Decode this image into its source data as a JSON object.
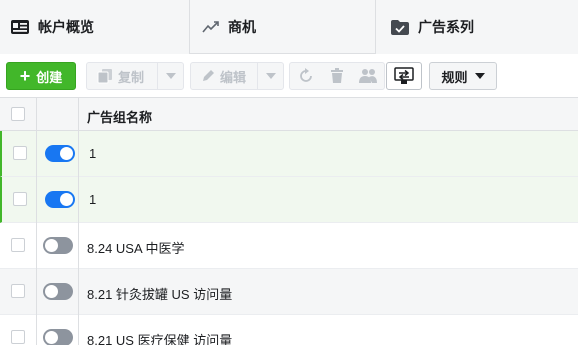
{
  "tabs": [
    {
      "label": "帐户概览",
      "icon": "account-overview-icon"
    },
    {
      "label": "商机",
      "icon": "trend-icon"
    },
    {
      "label": "广告系列",
      "icon": "folder-check-icon"
    }
  ],
  "toolbar": {
    "create_label": "创建",
    "copy_label": "复制",
    "edit_label": "编辑",
    "rules_label": "规则"
  },
  "table": {
    "header": {
      "name": "广告组名称"
    },
    "rows": [
      {
        "name": "1",
        "enabled": true,
        "selected": true
      },
      {
        "name": "1",
        "enabled": true,
        "selected": true
      },
      {
        "name": "8.24 USA 中医学",
        "enabled": false,
        "selected": false
      },
      {
        "name": "8.21 针灸拔罐 US 访问量",
        "enabled": false,
        "selected": false
      },
      {
        "name": "8.21 US 医疗保健 访问量",
        "enabled": false,
        "selected": false
      }
    ]
  },
  "colors": {
    "create_green": "#42b72a",
    "toggle_on": "#1877f2",
    "toggle_off": "#8d949e",
    "selected_row": "#f1f8ef"
  }
}
